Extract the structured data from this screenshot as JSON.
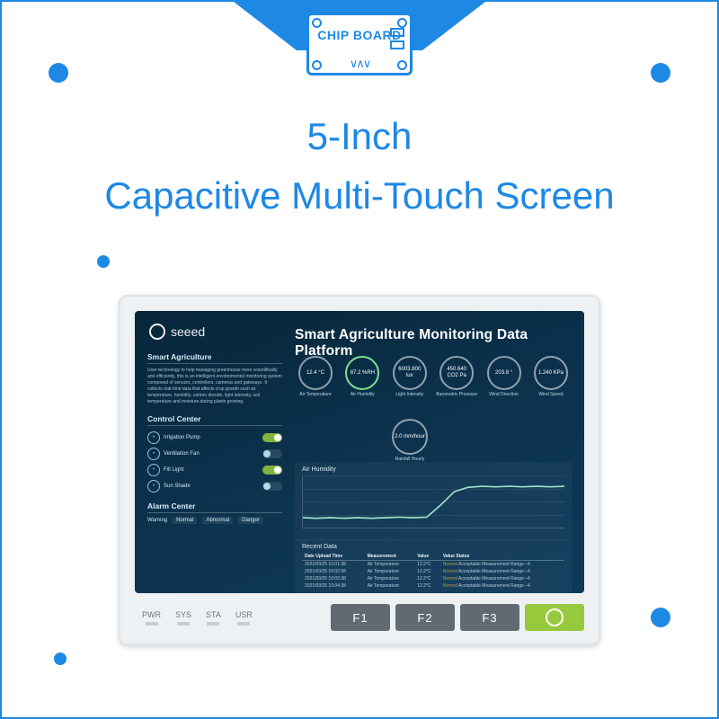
{
  "badge": {
    "label": "CHIP BOARD"
  },
  "headline": {
    "line1": "5-Inch",
    "line2": "Capacitive Multi-Touch Screen"
  },
  "device": {
    "brand": "seeed",
    "title": "Smart Agriculture Monitoring Data Platform",
    "sections": {
      "smart": {
        "heading": "Smart Agriculture",
        "body": "User technology to help managing greenhouse more scientifically and efficiently, this is an intelligent environmental monitoring system composed of sensors, controllers, cameras and gateways. It collects real-time data that affects crop growth such as temperature, humidity, carbon dioxide, light intensity, soil temperature and moisture during plants growing."
      },
      "control": {
        "heading": "Control Center",
        "rows": [
          {
            "icon": "water",
            "label": "Irrigation Pump",
            "on": true
          },
          {
            "icon": "fan",
            "label": "Ventilation Fan",
            "on": false
          },
          {
            "icon": "bulb",
            "label": "Fill Light",
            "on": true
          },
          {
            "icon": "sun",
            "label": "Sun Shade",
            "on": false
          }
        ]
      },
      "alarm": {
        "heading": "Alarm Center",
        "label": "Warning",
        "levels": [
          "Normal",
          "Abnormal",
          "Danger"
        ]
      }
    },
    "metrics": [
      {
        "value": "12.4 °C",
        "label": "Air Temperature"
      },
      {
        "value": "87.2 %RH",
        "label": "Air Humidity",
        "highlight": true
      },
      {
        "value": "6003.800 lux",
        "label": "Light Intensity"
      },
      {
        "value": "450.640 CO2 Pa",
        "label": "Barometric Pressure"
      },
      {
        "value": "203.8 °",
        "label": "Wind Direction"
      },
      {
        "value": "1.240 KPa",
        "label": "Wind Speed"
      }
    ],
    "rain": {
      "value": "2.0 mm/hour",
      "label": "Rainfall Hourly"
    },
    "chart_card": {
      "heading": "Air Humidity"
    },
    "recent": {
      "heading": "Recent Data",
      "headers": [
        "Date Upload Time",
        "Measurement",
        "Value",
        "Value Status"
      ],
      "rows": [
        {
          "dt": "2021/03/25 10:01:38",
          "m": "Air Temperature",
          "v": "12.2°C",
          "s": "Normal",
          "note": "Acceptable Measurement Range –4"
        },
        {
          "dt": "2021/03/25 10:02:58",
          "m": "Air Temperature",
          "v": "12.2°C",
          "s": "Normal",
          "note": "Acceptable Measurement Range –4"
        },
        {
          "dt": "2021/03/25 10:03:38",
          "m": "Air Temperature",
          "v": "12.2°C",
          "s": "Normal",
          "note": "Acceptable Measurement Range –4"
        },
        {
          "dt": "2021/03/25 10:04:38",
          "m": "Air Temperature",
          "v": "12.2°C",
          "s": "Normal",
          "note": "Acceptable Measurement Range –4"
        }
      ]
    },
    "leds": [
      "PWR",
      "SYS",
      "STA",
      "USR"
    ],
    "fkeys": [
      "F1",
      "F2",
      "F3"
    ]
  },
  "chart_data": {
    "type": "line",
    "title": "Air Humidity",
    "ylim": [
      0,
      100
    ],
    "x": [
      0,
      1,
      2,
      3,
      4,
      5,
      6,
      7,
      8,
      9,
      10,
      11,
      12,
      13,
      14,
      15,
      16,
      17,
      18,
      19
    ],
    "series": [
      {
        "name": "Air Humidity",
        "values": [
          22,
          21,
          22,
          21,
          22,
          21,
          22,
          23,
          22,
          23,
          45,
          70,
          78,
          80,
          79,
          80,
          79,
          80,
          79,
          80
        ]
      }
    ]
  }
}
